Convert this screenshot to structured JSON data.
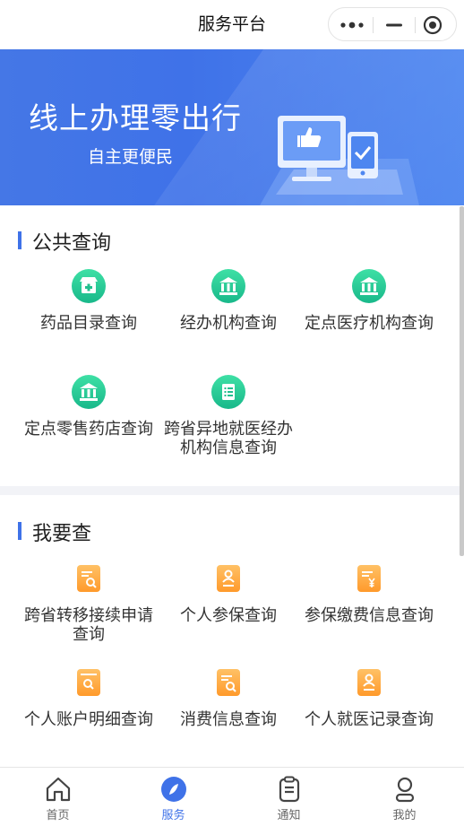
{
  "header": {
    "title": "服务平台"
  },
  "banner": {
    "title": "线上办理零出行",
    "subtitle": "自主更便民"
  },
  "public_query": {
    "title": "公共查询",
    "items": [
      {
        "label": "药品目录查询",
        "icon": "pharmacy-icon"
      },
      {
        "label": "经办机构查询",
        "icon": "institution-icon"
      },
      {
        "label": "定点医疗机构查询",
        "icon": "institution-icon"
      },
      {
        "label": "定点零售药店查询",
        "icon": "institution-icon"
      },
      {
        "label": "跨省异地就医经办机构信息查询",
        "icon": "document-icon"
      }
    ]
  },
  "my_query": {
    "title": "我要查",
    "items": [
      {
        "label": "跨省转移接续申请查询",
        "icon": "doc-search-icon"
      },
      {
        "label": "个人参保查询",
        "icon": "person-doc-icon"
      },
      {
        "label": "参保缴费信息查询",
        "icon": "yuan-doc-icon"
      },
      {
        "label": "个人账户明细查询",
        "icon": "account-search-icon"
      },
      {
        "label": "消费信息查询",
        "icon": "doc-search-icon"
      },
      {
        "label": "个人就医记录查询",
        "icon": "person-doc-icon"
      }
    ]
  },
  "tabbar": {
    "items": [
      {
        "label": "首页",
        "icon": "home-icon",
        "active": false
      },
      {
        "label": "服务",
        "icon": "compass-icon",
        "active": true
      },
      {
        "label": "通知",
        "icon": "clipboard-icon",
        "active": false
      },
      {
        "label": "我的",
        "icon": "user-icon",
        "active": false
      }
    ]
  },
  "colors": {
    "accent": "#3f72e8",
    "green_icon": "#21c28f",
    "orange_icon": "#ffa53a"
  }
}
